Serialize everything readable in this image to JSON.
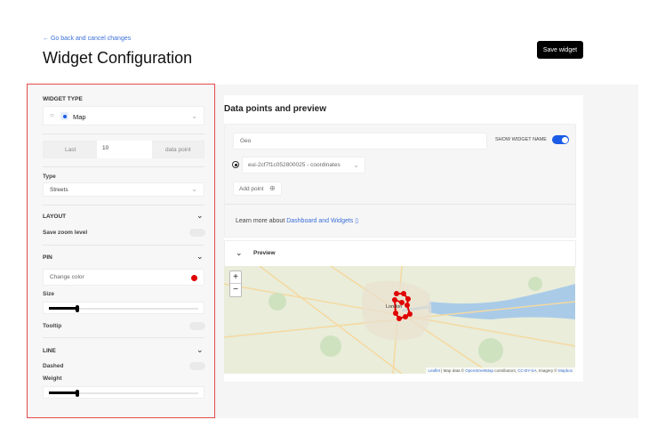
{
  "header": {
    "back_link": "← Go back and cancel changes",
    "title": "Widget Configuration",
    "save_label": "Save widget"
  },
  "left": {
    "widget_type_label": "WIDGET TYPE",
    "widget_type_value": "Map",
    "last_label": "Last",
    "last_value": "10",
    "data_point_label": "data point",
    "type_label": "Type",
    "type_value": "Streets",
    "layout_label": "LAYOUT",
    "save_zoom_label": "Save zoom level",
    "save_zoom_on": false,
    "pin_label": "PIN",
    "change_color_label": "Change color",
    "pin_color": "#e00000",
    "size_label": "Size",
    "size_value": 0.2,
    "tooltip_label": "Tooltip",
    "tooltip_on": false,
    "line_label": "LINE",
    "dashed_label": "Dashed",
    "dashed_on": false,
    "weight_label": "Weight",
    "weight_value": 0.2
  },
  "main": {
    "title": "Data points and preview",
    "name_value": "Geo",
    "show_name_label": "SHOW WIDGET NAME",
    "show_name_on": true,
    "datapoint": "eui-2cf7f1c052800025 - coordinates",
    "add_point": "Add point",
    "learn_text": "Learn more about ",
    "learn_link": "Dashboard and Widgets",
    "preview_label": "Preview",
    "map": {
      "city": "London",
      "zoom_in": "+",
      "zoom_out": "−",
      "attribution_leaflet": "Leaflet",
      "attribution_text": " | Map data © ",
      "osm": "OpenStreetMap",
      "contrib": " contributors, ",
      "ccbysa": "CC-BY-SA",
      "imagery": ", Imagery © ",
      "mapbox": "Mapbox"
    }
  },
  "colors": {
    "accent": "#1a5ce6",
    "pin": "#e00000",
    "border_highlight": "#e54b4b"
  }
}
